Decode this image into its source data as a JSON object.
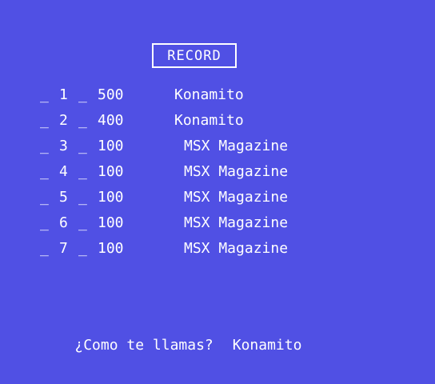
{
  "title": "RECORD",
  "rank_prefix": "_",
  "rank_separator": "_",
  "records": [
    {
      "rank": "1",
      "score": "500",
      "name": "Konamito"
    },
    {
      "rank": "2",
      "score": "400",
      "name": "Konamito"
    },
    {
      "rank": "3",
      "score": "100",
      "name": "MSX Magazine"
    },
    {
      "rank": "4",
      "score": "100",
      "name": "MSX Magazine"
    },
    {
      "rank": "5",
      "score": "100",
      "name": "MSX Magazine"
    },
    {
      "rank": "6",
      "score": "100",
      "name": "MSX Magazine"
    },
    {
      "rank": "7",
      "score": "100",
      "name": "MSX Magazine"
    }
  ],
  "prompt": {
    "question": "¿Como te llamas?",
    "answer": "Konamito"
  },
  "colors": {
    "background": "#5050e4",
    "text": "#ffffff"
  }
}
